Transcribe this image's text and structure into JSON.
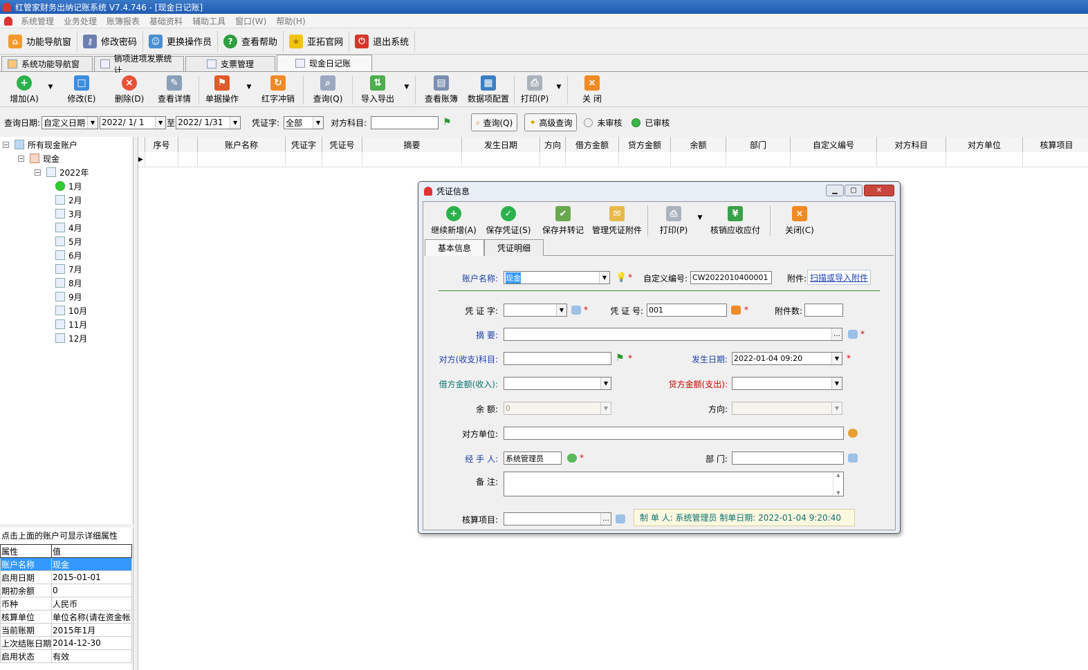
{
  "window": {
    "title": "红管家财务出纳记账系统 V7.4.746 - [现金日记账]"
  },
  "menu": [
    "系统管理",
    "业务处理",
    "账簿报表",
    "基础资料",
    "辅助工具",
    "窗口(W)",
    "帮助(H)"
  ],
  "nav": [
    "功能导航窗",
    "修改密码",
    "更换操作员",
    "查看帮助",
    "亚拓官网",
    "退出系统"
  ],
  "tabs": [
    "系统功能导航窗",
    "销项进项发票统计",
    "支票管理",
    "现金日记账"
  ],
  "toolbar": [
    "增加(A)",
    "修改(E)",
    "删除(D)",
    "查看详情",
    "单据操作",
    "红字冲销",
    "查询(Q)",
    "导入导出",
    "查看账簿",
    "数据项配置",
    "打印(P)",
    "关 闭"
  ],
  "query": {
    "date_label": "查询日期:",
    "date_mode": "自定义日期",
    "date_from": "2022/ 1/ 1",
    "to": "至",
    "date_to": "2022/ 1/31",
    "voucher_label": "凭证字:",
    "voucher_value": "全部",
    "subject_label": "对方科目:",
    "subject_value": "",
    "query_btn": "查询(Q)",
    "advanced_btn": "高级查询",
    "unaudited": "未审核",
    "audited": "已审核"
  },
  "tree": {
    "root": "所有现金账户",
    "account": "现金",
    "year": "2022年",
    "months": [
      "1月",
      "2月",
      "3月",
      "4月",
      "5月",
      "6月",
      "7月",
      "8月",
      "9月",
      "10月",
      "11月",
      "12月"
    ]
  },
  "props": {
    "caption": "点击上面的账户可显示详细属性",
    "header": [
      "属性",
      "值"
    ],
    "rows": [
      [
        "账户名称",
        "现金"
      ],
      [
        "启用日期",
        "2015-01-01"
      ],
      [
        "期初余额",
        "0"
      ],
      [
        "币种",
        "人民币"
      ],
      [
        "核算单位",
        "单位名称(请在资金帐"
      ],
      [
        "当前账期",
        "2015年1月"
      ],
      [
        "上次结账日期",
        "2014-12-30"
      ],
      [
        "启用状态",
        "有效"
      ]
    ]
  },
  "grid": {
    "columns": [
      "",
      "序号",
      "",
      "账户名称",
      "凭证字",
      "凭证号",
      "摘要",
      "发生日期",
      "方向",
      "借方金额",
      "贷方金额",
      "余额",
      "部门",
      "自定义编号",
      "对方科目",
      "对方单位",
      "核算项目"
    ]
  },
  "dialog": {
    "title": "凭证信息",
    "toolbar": [
      "继续新增(A)",
      "保存凭证(S)",
      "保存并转记",
      "管理凭证附件",
      "打印(P)",
      "核销应收应付",
      "关闭(C)"
    ],
    "tabs": [
      "基本信息",
      "凭证明细"
    ],
    "form": {
      "account_label": "账户名称:",
      "account_value": "现金",
      "custom_no_label": "自定义编号:",
      "custom_no_value": "CW2022010400001",
      "attach_label": "附件:",
      "attach_link": "扫描或导入附件",
      "voucher_label": "凭 证 字:",
      "voucher_value": "",
      "voucher_no_label": "凭 证 号:",
      "voucher_no_value": "001",
      "attach_count_label": "附件数:",
      "attach_count_value": "",
      "summary_label": "摘    要:",
      "summary_value": "",
      "subject_label": "对方(收支)科目:",
      "subject_value": "",
      "date_label": "发生日期:",
      "date_value": "2022-01-04 09:20",
      "debit_label": "借方金额(收入):",
      "debit_value": "",
      "credit_label": "贷方金额(支出):",
      "credit_value": "",
      "balance_label": "余    额:",
      "balance_value": "0",
      "direction_label": "方向:",
      "direction_value": "",
      "party_label": "对方单位:",
      "party_value": "",
      "handler_label": "经 手 人:",
      "handler_value": "系统管理员",
      "dept_label": "部    门:",
      "dept_value": "",
      "remark_label": "备    注:",
      "remark_value": "",
      "item_label": "核算项目:",
      "item_value": "",
      "maker_info": "制 单 人: 系统管理员  制单日期: 2022-01-04 9:20:40"
    }
  }
}
